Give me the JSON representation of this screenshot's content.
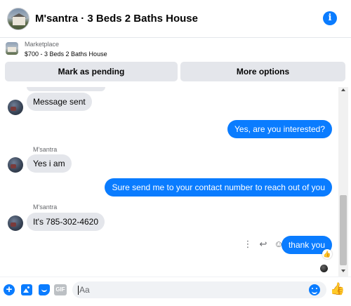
{
  "header": {
    "title": "M'santra · 3 Beds 2 Baths House",
    "info_icon": "info-icon"
  },
  "listing": {
    "source": "Marketplace",
    "price_title": "$700 - 3 Beds 2 Baths House",
    "mark_pending_label": "Mark as pending",
    "more_options_label": "More options"
  },
  "conversation": {
    "sender_name": "M'santra",
    "messages": [
      {
        "direction": "in",
        "text": "Message sent"
      },
      {
        "direction": "out",
        "text": "Yes, are you interested?"
      },
      {
        "direction": "in",
        "sender": "M'santra",
        "text": "Yes i am"
      },
      {
        "direction": "out",
        "text": "Sure send me to your contact number to reach out of you"
      },
      {
        "direction": "in",
        "sender": "M'santra",
        "text": "It's 785-302-4620"
      },
      {
        "direction": "out",
        "text": "thank you",
        "reaction": "thumbs-up"
      }
    ]
  },
  "composer": {
    "placeholder": "Aa",
    "gif_label": "GIF"
  },
  "colors": {
    "accent": "#0a7cff",
    "incoming_bubble": "#e4e6eb",
    "button_bg": "#e4e6eb"
  }
}
